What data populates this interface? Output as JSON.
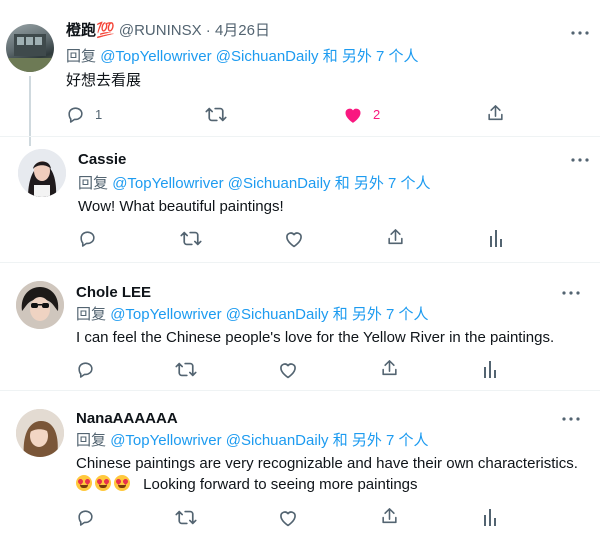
{
  "tweets": [
    {
      "name": "橙跑💯",
      "handle": "@RUNINSX",
      "separator": "·",
      "date": "4月26日",
      "reply_prefix": "回复",
      "mention_1": "@TopYellowriver",
      "mention_2": "@SichuanDaily",
      "reply_suffix": "和 另外 7 个人",
      "text": "好想去看展",
      "reply_count": "1",
      "like_count": "2"
    },
    {
      "name": "Cassie",
      "reply_prefix": "回复",
      "mention_1": "@TopYellowriver",
      "mention_2": "@SichuanDaily",
      "reply_suffix": "和 另外 7 个人",
      "text": "Wow! What beautiful paintings!"
    },
    {
      "name": "Chole LEE",
      "reply_prefix": "回复",
      "mention_1": "@TopYellowriver",
      "mention_2": "@SichuanDaily",
      "reply_suffix": "和 另外 7 个人",
      "text": "I can feel the Chinese people's love for the Yellow River in the paintings."
    },
    {
      "name": "NanaAAAAAA",
      "reply_prefix": "回复",
      "mention_1": "@TopYellowriver",
      "mention_2": "@SichuanDaily",
      "reply_suffix": "和 另外 7 个人",
      "text_line_1": "Chinese paintings are very recognizable and have their own characteristics.",
      "text_line_2": "Looking forward to seeing more paintings"
    }
  ],
  "colors": {
    "accent": "#1d9bf0",
    "like": "#f91880",
    "muted": "#536471",
    "divider": "#eff3f4"
  },
  "icons": [
    "reply-icon",
    "retweet-icon",
    "like-icon",
    "share-icon",
    "analytics-icon",
    "more-icon"
  ]
}
